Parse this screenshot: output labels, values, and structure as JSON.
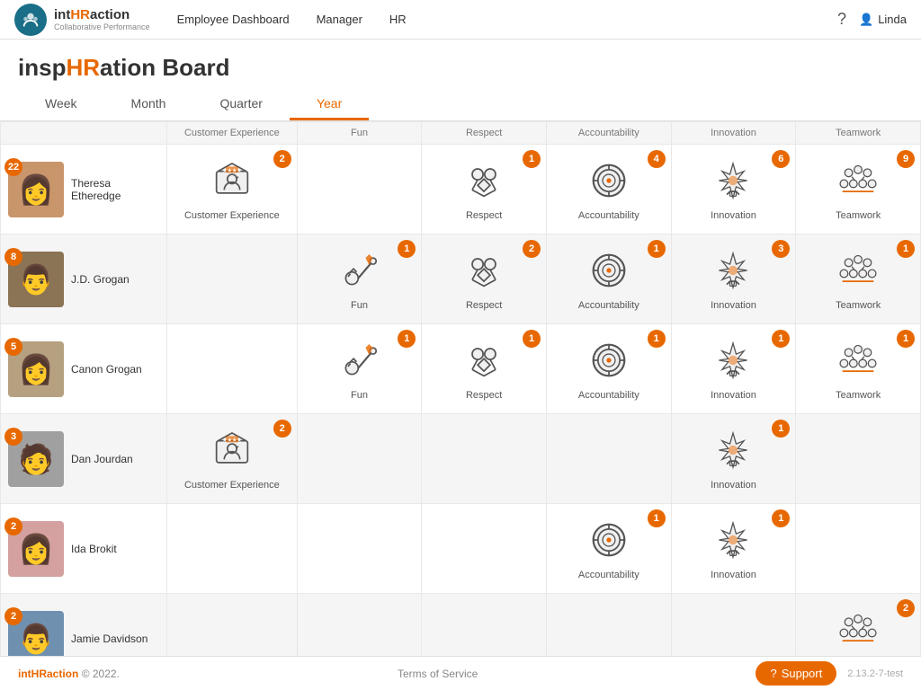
{
  "nav": {
    "logo_main": "intHRaction",
    "logo_main_hr": "HR",
    "logo_sub": "Collaborative Performance",
    "links": [
      "Employee Dashboard",
      "Manager",
      "HR"
    ],
    "user": "Linda"
  },
  "page": {
    "title_pre": "insp",
    "title_hr": "HR",
    "title_post": "ation Board"
  },
  "tabs": [
    {
      "label": "Week",
      "active": false
    },
    {
      "label": "Month",
      "active": false
    },
    {
      "label": "Quarter",
      "active": false
    },
    {
      "label": "Year",
      "active": true
    }
  ],
  "columns": [
    "",
    "Customer Experience",
    "Fun",
    "Respect",
    "Accountability",
    "Innovation",
    "Teamwork"
  ],
  "rows": [
    {
      "name": "Theresa Etheredge",
      "total": 22,
      "bg": "white",
      "values": [
        {
          "col": "Customer Experience",
          "count": 2,
          "empty": false
        },
        {
          "col": "Fun",
          "count": 0,
          "empty": true
        },
        {
          "col": "Respect",
          "count": 1,
          "empty": false
        },
        {
          "col": "Accountability",
          "count": 4,
          "empty": false
        },
        {
          "col": "Innovation",
          "count": 6,
          "empty": false
        },
        {
          "col": "Teamwork",
          "count": 9,
          "empty": false
        }
      ]
    },
    {
      "name": "J.D. Grogan",
      "total": 8,
      "bg": "gray",
      "values": [
        {
          "col": "Customer Experience",
          "count": 0,
          "empty": true
        },
        {
          "col": "Fun",
          "count": 1,
          "empty": false
        },
        {
          "col": "Respect",
          "count": 2,
          "empty": false
        },
        {
          "col": "Accountability",
          "count": 1,
          "empty": false
        },
        {
          "col": "Innovation",
          "count": 3,
          "empty": false
        },
        {
          "col": "Teamwork",
          "count": 1,
          "empty": false
        }
      ]
    },
    {
      "name": "Canon Grogan",
      "total": 5,
      "bg": "white",
      "values": [
        {
          "col": "Customer Experience",
          "count": 0,
          "empty": true
        },
        {
          "col": "Fun",
          "count": 1,
          "empty": false
        },
        {
          "col": "Respect",
          "count": 1,
          "empty": false
        },
        {
          "col": "Accountability",
          "count": 1,
          "empty": false
        },
        {
          "col": "Innovation",
          "count": 1,
          "empty": false
        },
        {
          "col": "Teamwork",
          "count": 1,
          "empty": false
        }
      ]
    },
    {
      "name": "Dan Jourdan",
      "total": 3,
      "bg": "gray",
      "values": [
        {
          "col": "Customer Experience",
          "count": 2,
          "empty": false
        },
        {
          "col": "Fun",
          "count": 0,
          "empty": true
        },
        {
          "col": "Respect",
          "count": 0,
          "empty": true
        },
        {
          "col": "Accountability",
          "count": 0,
          "empty": true
        },
        {
          "col": "Innovation",
          "count": 1,
          "empty": false
        },
        {
          "col": "Teamwork",
          "count": 0,
          "empty": true
        }
      ]
    },
    {
      "name": "Ida Brokit",
      "total": 2,
      "bg": "white",
      "values": [
        {
          "col": "Customer Experience",
          "count": 0,
          "empty": true
        },
        {
          "col": "Fun",
          "count": 0,
          "empty": true
        },
        {
          "col": "Respect",
          "count": 0,
          "empty": true
        },
        {
          "col": "Accountability",
          "count": 1,
          "empty": false
        },
        {
          "col": "Innovation",
          "count": 1,
          "empty": false
        },
        {
          "col": "Teamwork",
          "count": 0,
          "empty": true
        }
      ]
    },
    {
      "name": "Jamie Davidson",
      "total": 2,
      "bg": "gray",
      "values": [
        {
          "col": "Customer Experience",
          "count": 0,
          "empty": true
        },
        {
          "col": "Fun",
          "count": 0,
          "empty": true
        },
        {
          "col": "Respect",
          "count": 0,
          "empty": true
        },
        {
          "col": "Accountability",
          "count": 0,
          "empty": true
        },
        {
          "col": "Innovation",
          "count": 0,
          "empty": true
        },
        {
          "col": "Teamwork",
          "count": 2,
          "empty": false
        }
      ]
    }
  ],
  "footer": {
    "brand": "intHRaction",
    "copyright": "© 2022.",
    "tos": "Terms of Service",
    "support": "Support",
    "version": "2.13.2-7-test"
  }
}
